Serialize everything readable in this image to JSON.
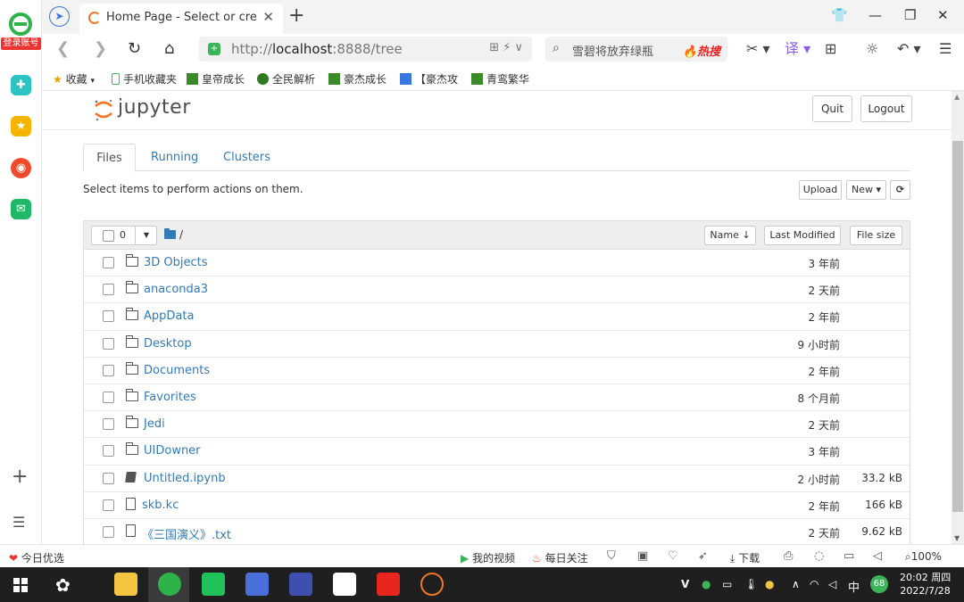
{
  "browser": {
    "sidebar": {
      "login_label": "登录账号"
    },
    "tab": {
      "title": "Home Page - Select or create a notebook",
      "close_glyph": "✕",
      "new_glyph": "+"
    },
    "window_controls": [
      "👕",
      "—",
      "❐",
      "✕"
    ],
    "address": {
      "url_prefix": "http://",
      "url_host": "localhost",
      "url_rest": ":8888/tree",
      "right_icons": "⊞  ⚡  ∨"
    },
    "search": {
      "placeholder": "雪碧将放弃绿瓶",
      "hot_label": "🔥热搜"
    },
    "toolbar_icons": [
      "✂ ▾",
      "译 ▾",
      "⊞",
      "☼",
      "↶ ▾",
      "☰"
    ],
    "bookmarks": [
      {
        "label": "收藏",
        "icon": "star-icon",
        "color": "#f0a000"
      },
      {
        "label": "手机收藏夹",
        "icon": "phone-icon",
        "color": "#3cb55a"
      },
      {
        "label": "皇帝成长",
        "icon": "game-icon",
        "color": "#3a8a2a"
      },
      {
        "label": "全民解析",
        "icon": "game-icon",
        "color": "#2f7a20"
      },
      {
        "label": "豪杰成长",
        "icon": "game-icon",
        "color": "#3a8a2a"
      },
      {
        "label": "【豪杰攻",
        "icon": "page-icon",
        "color": "#3a76e0"
      },
      {
        "label": "青鸾繁华",
        "icon": "game-icon",
        "color": "#3a8a2a"
      }
    ]
  },
  "jupyter": {
    "logo_text": "jupyter",
    "quit_label": "Quit",
    "logout_label": "Logout",
    "tabs": [
      "Files",
      "Running",
      "Clusters"
    ],
    "instructions": "Select items to perform actions on them.",
    "upload_label": "Upload",
    "new_label": "New ▾",
    "refresh_glyph": "⟳",
    "selected_count": "0",
    "breadcrumb": "/",
    "col_name": "Name ↓",
    "col_modified": "Last Modified",
    "col_size": "File size",
    "items": [
      {
        "name": "3D Objects",
        "type": "folder",
        "modified": "3 年前",
        "size": ""
      },
      {
        "name": "anaconda3",
        "type": "folder",
        "modified": "2 天前",
        "size": ""
      },
      {
        "name": "AppData",
        "type": "folder",
        "modified": "2 年前",
        "size": ""
      },
      {
        "name": "Desktop",
        "type": "folder",
        "modified": "9 小时前",
        "size": ""
      },
      {
        "name": "Documents",
        "type": "folder",
        "modified": "2 年前",
        "size": ""
      },
      {
        "name": "Favorites",
        "type": "folder",
        "modified": "8 个月前",
        "size": ""
      },
      {
        "name": "Jedi",
        "type": "folder",
        "modified": "2 天前",
        "size": ""
      },
      {
        "name": "UIDowner",
        "type": "folder",
        "modified": "3 年前",
        "size": ""
      },
      {
        "name": "Untitled.ipynb",
        "type": "notebook",
        "modified": "2 小时前",
        "size": "33.2 kB"
      },
      {
        "name": "skb.kc",
        "type": "file",
        "modified": "2 年前",
        "size": "166 kB"
      },
      {
        "name": "《三国演义》.txt",
        "type": "file",
        "modified": "2 天前",
        "size": "9.62 kB"
      }
    ]
  },
  "statusbar": {
    "left_label": "今日优选",
    "video_label": "我的视频",
    "follow_label": "每日关注",
    "download_label": "下载",
    "zoom_label": "100%"
  },
  "taskbar": {
    "ime_label": "中",
    "badge": "68",
    "time": "20:02 周四",
    "date": "2022/7/28"
  }
}
